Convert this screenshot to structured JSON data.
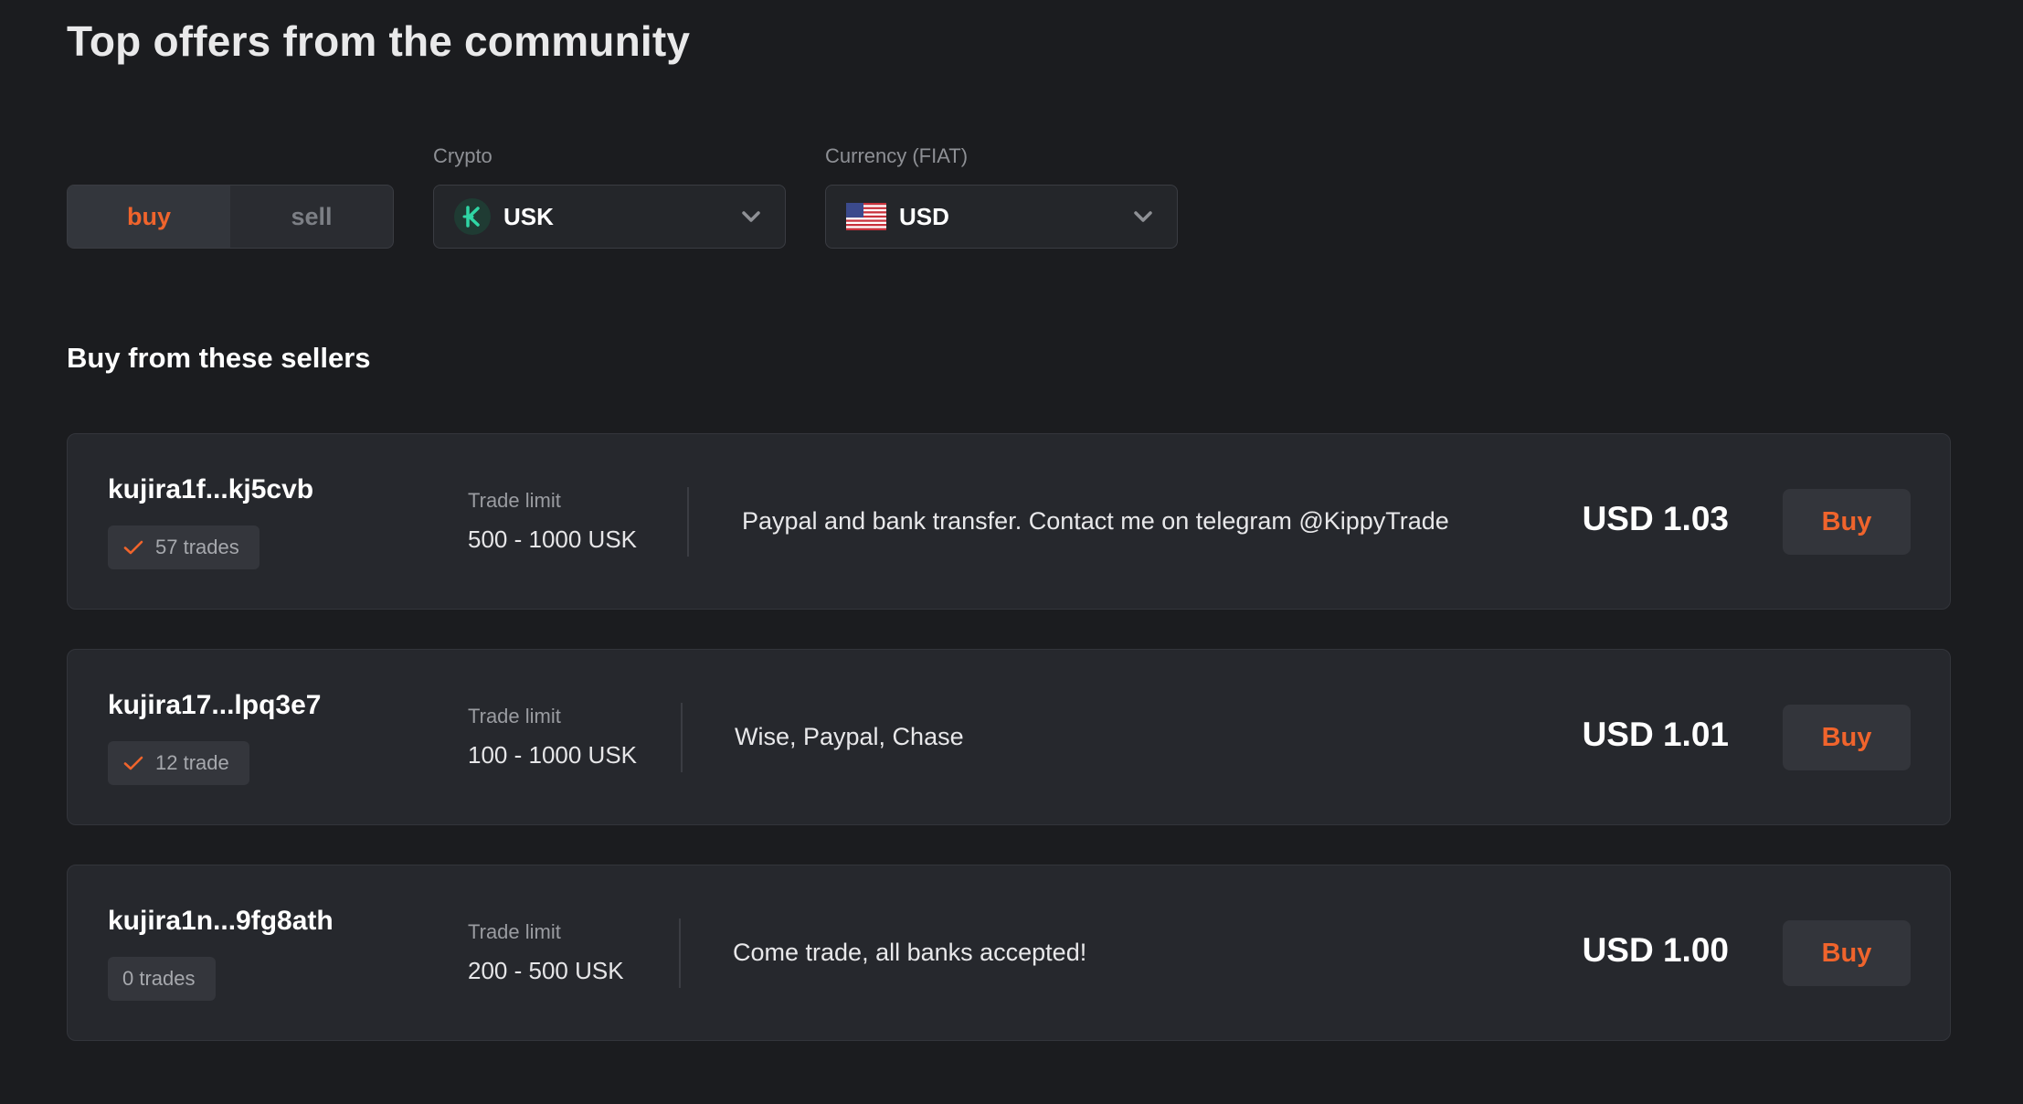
{
  "page": {
    "title": "Top offers from the community"
  },
  "filters": {
    "mode": {
      "buy_label": "buy",
      "sell_label": "sell",
      "active": "buy"
    },
    "crypto": {
      "label": "Crypto",
      "value": "USK",
      "icon": "usk-coin-icon"
    },
    "fiat": {
      "label": "Currency (FIAT)",
      "value": "USD",
      "icon": "us-flag-icon"
    }
  },
  "section": {
    "title": "Buy from these sellers"
  },
  "offers": [
    {
      "seller": "kujira1f...kj5cvb",
      "trades": "57 trades",
      "verified": true,
      "trade_limit_label": "Trade limit",
      "trade_limit": "500 - 1000 USK",
      "description": "Paypal and bank transfer. Contact me on telegram @KippyTrade",
      "price": "USD 1.03",
      "button": "Buy"
    },
    {
      "seller": "kujira17...lpq3e7",
      "trades": "12 trade",
      "verified": true,
      "trade_limit_label": "Trade limit",
      "trade_limit": "100 - 1000 USK",
      "description": "Wise, Paypal, Chase",
      "price": "USD 1.01",
      "button": "Buy"
    },
    {
      "seller": "kujira1n...9fg8ath",
      "trades": "0 trades",
      "verified": false,
      "trade_limit_label": "Trade limit",
      "trade_limit": "200 - 500 USK",
      "description": "Come trade, all banks accepted!",
      "price": "USD 1.00",
      "button": "Buy"
    }
  ],
  "colors": {
    "background": "#1b1c1f",
    "card": "#26282d",
    "accent": "#f0642c",
    "usk_green": "#2fd6a4"
  }
}
